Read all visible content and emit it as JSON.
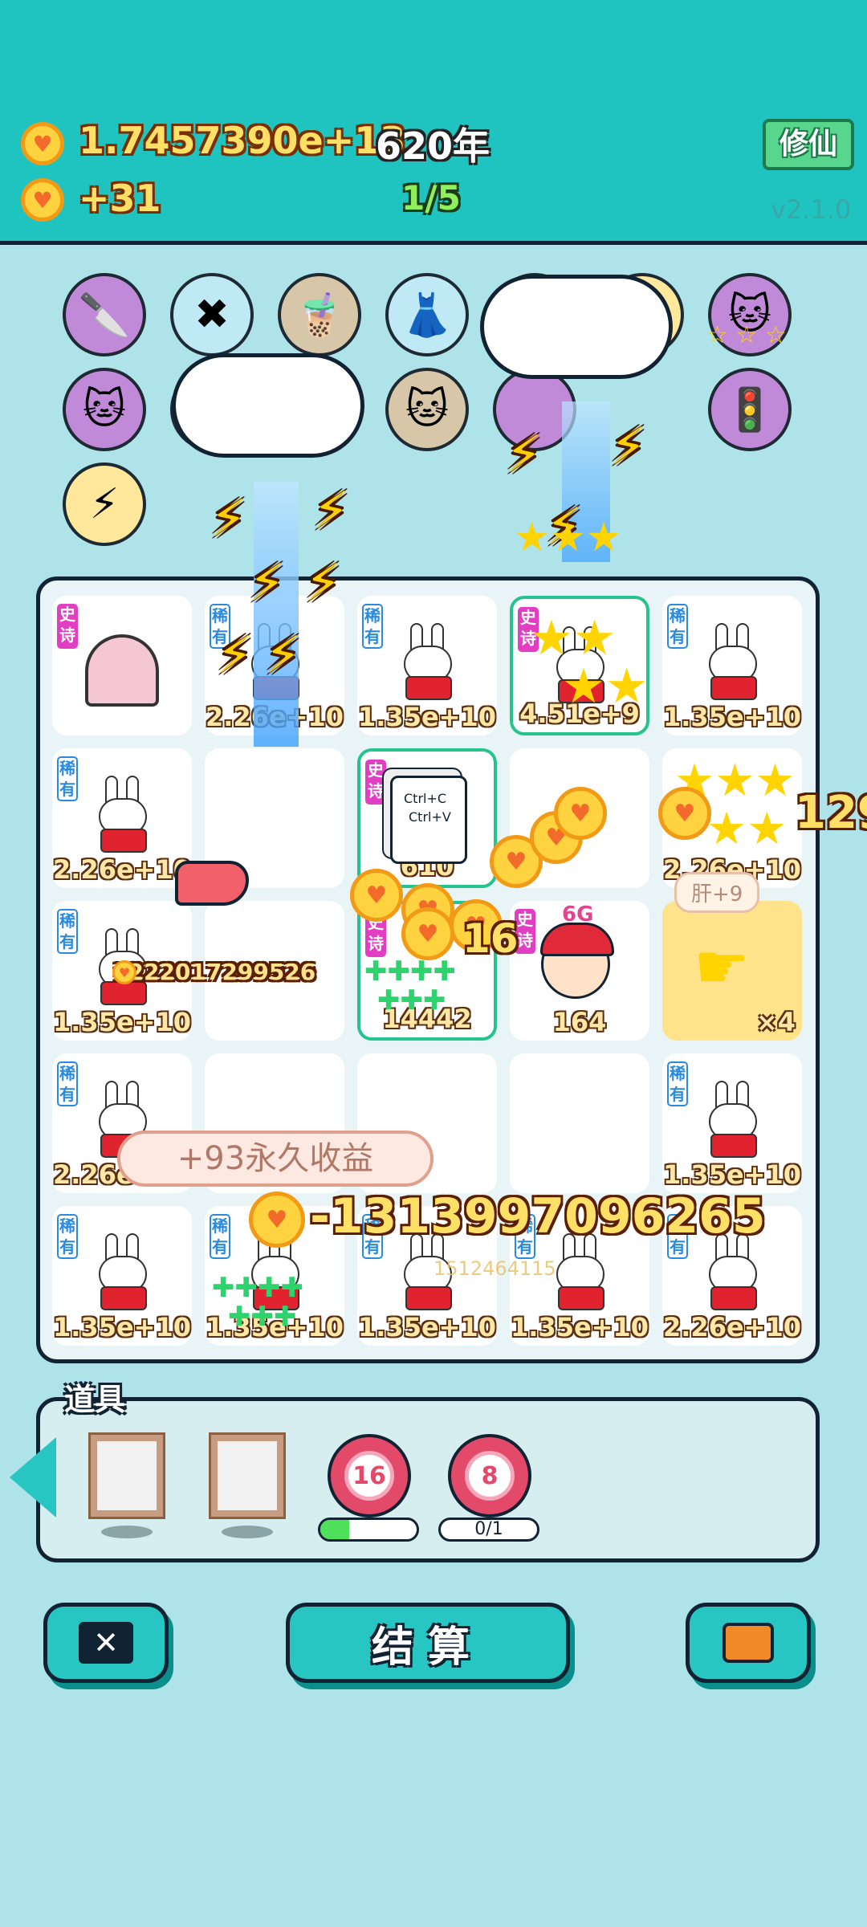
{
  "header": {
    "coins": "1.7457390e+13",
    "years": "620年",
    "income": "+31",
    "progress": "1/5",
    "cultivate_button": "修仙",
    "version": "v2.1.0"
  },
  "board": {
    "cells": [
      {
        "tag": "史诗",
        "value": ""
      },
      {
        "tag": "稀有",
        "value": "2.26e+10"
      },
      {
        "tag": "稀有",
        "value": "1.35e+10"
      },
      {
        "tag": "史诗",
        "value": "4.51e+9"
      },
      {
        "tag": "稀有",
        "value": "1.35e+10"
      },
      {
        "tag": "稀有",
        "value": "2.26e+10"
      },
      {
        "tag": "",
        "value": ""
      },
      {
        "tag": "史诗",
        "value": "610"
      },
      {
        "tag": "",
        "value": ""
      },
      {
        "tag": "",
        "value": "2.26e+10"
      },
      {
        "tag": "稀有",
        "value": "1.35e+10"
      },
      {
        "tag": "",
        "value": ""
      },
      {
        "tag": "史诗",
        "value": "14442"
      },
      {
        "tag": "史诗",
        "value": "164"
      },
      {
        "tag": "",
        "value": "×4"
      },
      {
        "tag": "稀有",
        "value": "2.26e+10"
      },
      {
        "tag": "",
        "value": ""
      },
      {
        "tag": "",
        "value": ""
      },
      {
        "tag": "",
        "value": ""
      },
      {
        "tag": "稀有",
        "value": "1.35e+10"
      },
      {
        "tag": "稀有",
        "value": "1.35e+10"
      },
      {
        "tag": "稀有",
        "value": "1.35e+10"
      },
      {
        "tag": "稀有",
        "value": "1.35e+10"
      },
      {
        "tag": "稀有",
        "value": "1.35e+10"
      },
      {
        "tag": "稀有",
        "value": "2.26e+10"
      }
    ],
    "copy_card": {
      "line1": "Ctrl+C",
      "line2": "Ctrl+V"
    },
    "signal_label": "6G",
    "liver_bubble": "肝+9"
  },
  "effects": {
    "permanent_income": "+93永久收益",
    "big_loss": "-1313997096265",
    "float_1": "1222017299526",
    "float_2": "1512464115",
    "float_3": "16",
    "float_4": "129"
  },
  "props": {
    "title": "道具",
    "target_1": "16",
    "target_1_progress": 0.3,
    "target_2": "8",
    "target_2_progress_text": "0/1"
  },
  "actions": {
    "settle_label": "结算"
  },
  "colors": {
    "header_bg": "#1fc4c1",
    "background": "#aee3ea",
    "button": "#27c6c3",
    "rare": "#2a8ae0",
    "epic": "#e23ec3"
  }
}
